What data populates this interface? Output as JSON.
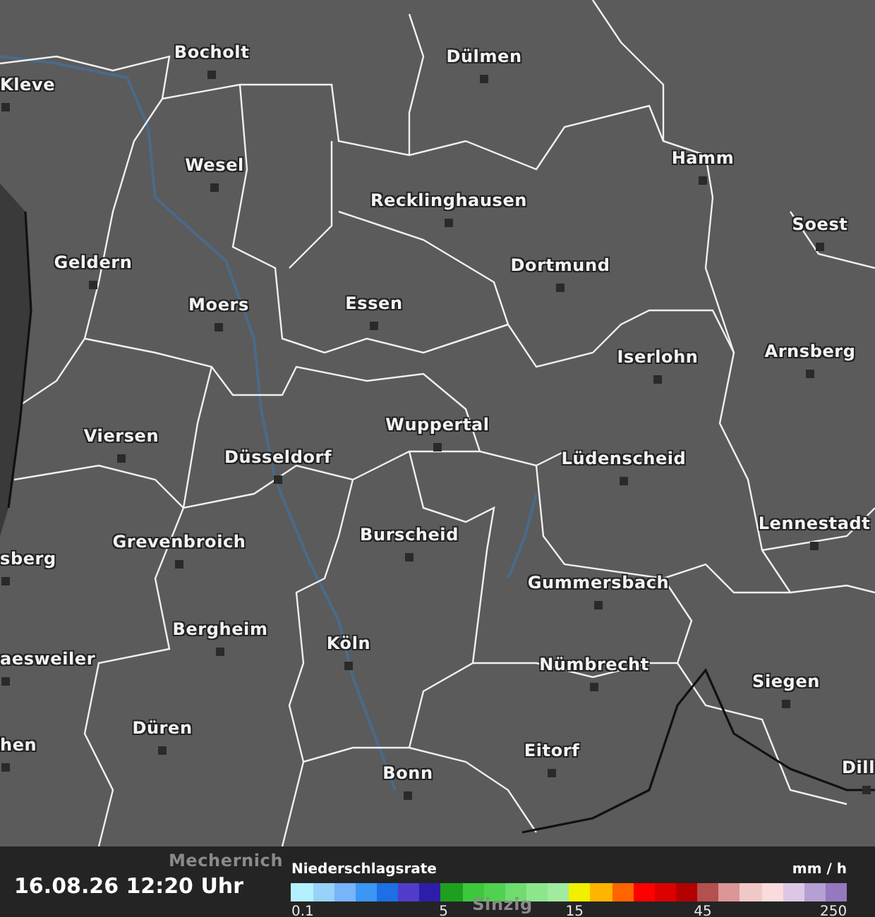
{
  "map": {
    "cities": [
      {
        "name": "Bocholt",
        "faded": false
      },
      {
        "name": "Dülmen",
        "faded": false
      },
      {
        "name": "Kleve",
        "faded": false
      },
      {
        "name": "Wesel",
        "faded": false
      },
      {
        "name": "Hamm",
        "faded": false
      },
      {
        "name": "Recklinghausen",
        "faded": false
      },
      {
        "name": "Soest",
        "faded": false
      },
      {
        "name": "Geldern",
        "faded": false
      },
      {
        "name": "Dortmund",
        "faded": false
      },
      {
        "name": "Moers",
        "faded": false
      },
      {
        "name": "Essen",
        "faded": false
      },
      {
        "name": "Arnsberg",
        "faded": false
      },
      {
        "name": "Iserlohn",
        "faded": false
      },
      {
        "name": "Wuppertal",
        "faded": false
      },
      {
        "name": "Viersen",
        "faded": false
      },
      {
        "name": "Düsseldorf",
        "faded": false
      },
      {
        "name": "Lüdenscheid",
        "faded": false
      },
      {
        "name": "Lennestadt",
        "faded": false
      },
      {
        "name": "Grevenbroich",
        "faded": false
      },
      {
        "name": "Burscheid",
        "faded": false
      },
      {
        "name": "sberg",
        "faded": false
      },
      {
        "name": "Gummersbach",
        "faded": false
      },
      {
        "name": "Bergheim",
        "faded": false
      },
      {
        "name": "Köln",
        "faded": false
      },
      {
        "name": "aesweiler",
        "faded": false
      },
      {
        "name": "Nümbrecht",
        "faded": false
      },
      {
        "name": "Siegen",
        "faded": false
      },
      {
        "name": "Düren",
        "faded": false
      },
      {
        "name": "hen",
        "faded": false
      },
      {
        "name": "Eitorf",
        "faded": false
      },
      {
        "name": "Dill",
        "faded": false
      },
      {
        "name": "Bonn",
        "faded": false
      },
      {
        "name": "Mechernich",
        "faded": true
      },
      {
        "name": "Sinzig",
        "faded": true
      }
    ]
  },
  "footer": {
    "timestamp": "16.08.26 12:20 Uhr",
    "legend": {
      "title": "Niederschlagsrate",
      "unit": "mm / h",
      "swatches": [
        {
          "color": "#b4f0ff",
          "label": "0.1"
        },
        {
          "color": "#96d2fa"
        },
        {
          "color": "#78b4fa"
        },
        {
          "color": "#3c96f5"
        },
        {
          "color": "#1e6ee6"
        },
        {
          "color": "#503cc8"
        },
        {
          "color": "#2d1eaa"
        },
        {
          "color": "#1ea01e",
          "label": "5"
        },
        {
          "color": "#3cc83c"
        },
        {
          "color": "#50d250"
        },
        {
          "color": "#6edc6e"
        },
        {
          "color": "#8ce68c"
        },
        {
          "color": "#a0eba0"
        },
        {
          "color": "#f0f000",
          "label": "15"
        },
        {
          "color": "#ffb400"
        },
        {
          "color": "#ff6400"
        },
        {
          "color": "#ff0000"
        },
        {
          "color": "#dc0000"
        },
        {
          "color": "#b40000"
        },
        {
          "color": "#b45050",
          "label": "45"
        },
        {
          "color": "#dc9696"
        },
        {
          "color": "#f0c8c8"
        },
        {
          "color": "#fadcdc"
        },
        {
          "color": "#dcc8e6"
        },
        {
          "color": "#b4a0d2"
        },
        {
          "color": "#9678be",
          "label": "250"
        }
      ]
    }
  }
}
